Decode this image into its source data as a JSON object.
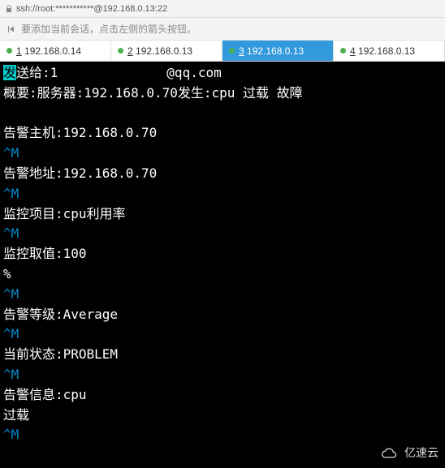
{
  "urlbar": {
    "text": "ssh://root:***********@192.168.0.13:22"
  },
  "hint": {
    "text": "要添加当前会话，点击左侧的箭头按钮。"
  },
  "tabs": [
    {
      "num": "1",
      "label": "192.168.0.14",
      "dot": "green",
      "active": false
    },
    {
      "num": "2",
      "label": "192.168.0.13",
      "dot": "green",
      "active": false
    },
    {
      "num": "3",
      "label": "192.168.0.13",
      "dot": "green",
      "active": true
    },
    {
      "num": "4",
      "label": "192.168.0.13",
      "dot": "green",
      "active": false
    }
  ],
  "terminal": {
    "send_prefix_hl": "发",
    "send_prefix": "送给:1",
    "send_suffix": "@qq.com",
    "summary": "概要:服务器:192.168.0.70发生:cpu 过载 故障",
    "alarm_host": "告警主机:192.168.0.70",
    "alarm_addr": "告警地址:192.168.0.70",
    "monitor_item": "监控项目:cpu利用率",
    "monitor_val": "监控取值:100",
    "percent": "%",
    "alarm_level": "告警等级:Average",
    "status": "当前状态:PROBLEM",
    "alarm_info": "告警信息:cpu",
    "overload": "过载",
    "cm": "^M"
  },
  "watermark": {
    "text": "亿速云"
  }
}
